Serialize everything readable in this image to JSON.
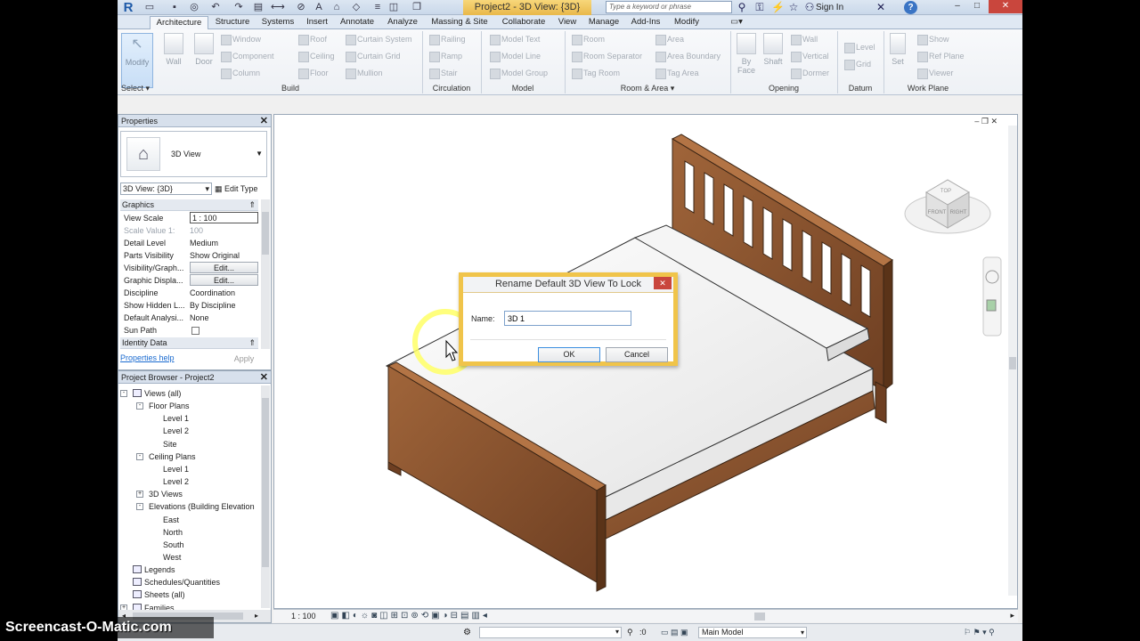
{
  "titlebar": {
    "title": "Project2 - 3D View: {3D}",
    "search_placeholder": "Type a keyword or phrase",
    "signin": "Sign In"
  },
  "ribbon_tabs": [
    "Architecture",
    "Structure",
    "Systems",
    "Insert",
    "Annotate",
    "Analyze",
    "Massing & Site",
    "Collaborate",
    "View",
    "Manage",
    "Add-Ins",
    "Modify"
  ],
  "ribbon": {
    "modify": "Modify",
    "select": "Select",
    "wall": "Wall",
    "door": "Door",
    "build_items": [
      "Window",
      "Component",
      "Column",
      "Roof",
      "Ceiling",
      "Floor",
      "Curtain System",
      "Curtain Grid",
      "Mullion"
    ],
    "circulation_items": [
      "Railing",
      "Ramp",
      "Stair"
    ],
    "model_items": [
      "Model Text",
      "Model Line",
      "Model Group"
    ],
    "room_items": [
      "Room",
      "Room Separator",
      "Tag Room",
      "Area",
      "Area Boundary",
      "Tag Area"
    ],
    "opening_items": [
      "By Face",
      "Shaft",
      "Wall",
      "Vertical",
      "Dormer"
    ],
    "datum_items": [
      "Level",
      "Grid"
    ],
    "workplane_items": [
      "Set",
      "Show",
      "Ref Plane",
      "Viewer"
    ],
    "panels": [
      "Build",
      "Circulation",
      "Model",
      "Room & Area",
      "Opening",
      "Datum",
      "Work Plane"
    ]
  },
  "properties": {
    "title": "Properties",
    "type_name": "3D View",
    "instance": "3D View: {3D}",
    "edit_type": "Edit Type",
    "group_graphics": "Graphics",
    "group_identity": "Identity Data",
    "rows": [
      {
        "name": "View Scale",
        "value": "1 : 100"
      },
      {
        "name": "Scale Value    1:",
        "value": "100"
      },
      {
        "name": "Detail Level",
        "value": "Medium"
      },
      {
        "name": "Parts Visibility",
        "value": "Show Original"
      },
      {
        "name": "Visibility/Graph...",
        "value": "Edit..."
      },
      {
        "name": "Graphic Displa...",
        "value": "Edit..."
      },
      {
        "name": "Discipline",
        "value": "Coordination"
      },
      {
        "name": "Show Hidden L...",
        "value": "By Discipline"
      },
      {
        "name": "Default Analysi...",
        "value": "None"
      },
      {
        "name": "Sun Path",
        "value": ""
      }
    ],
    "help": "Properties help",
    "apply": "Apply"
  },
  "browser": {
    "title": "Project Browser - Project2",
    "items": [
      {
        "label": "Views (all)",
        "indent": 0,
        "toggle": "-"
      },
      {
        "label": "Floor Plans",
        "indent": 1,
        "toggle": "-"
      },
      {
        "label": "Level 1",
        "indent": 2,
        "toggle": ""
      },
      {
        "label": "Level 2",
        "indent": 2,
        "toggle": ""
      },
      {
        "label": "Site",
        "indent": 2,
        "toggle": ""
      },
      {
        "label": "Ceiling Plans",
        "indent": 1,
        "toggle": "-"
      },
      {
        "label": "Level 1",
        "indent": 2,
        "toggle": ""
      },
      {
        "label": "Level 2",
        "indent": 2,
        "toggle": ""
      },
      {
        "label": "3D Views",
        "indent": 1,
        "toggle": "+"
      },
      {
        "label": "Elevations (Building Elevation",
        "indent": 1,
        "toggle": "-"
      },
      {
        "label": "East",
        "indent": 2,
        "toggle": ""
      },
      {
        "label": "North",
        "indent": 2,
        "toggle": ""
      },
      {
        "label": "South",
        "indent": 2,
        "toggle": ""
      },
      {
        "label": "West",
        "indent": 2,
        "toggle": ""
      },
      {
        "label": "Legends",
        "indent": 0,
        "toggle": ""
      },
      {
        "label": "Schedules/Quantities",
        "indent": 0,
        "toggle": ""
      },
      {
        "label": "Sheets (all)",
        "indent": 0,
        "toggle": ""
      },
      {
        "label": "Families",
        "indent": 0,
        "toggle": "+"
      }
    ]
  },
  "viewcube": {
    "top": "TOP",
    "front": "FRONT",
    "right": "RIGHT"
  },
  "view_controls": {
    "scale": "1 : 100"
  },
  "status": {
    "coord": ":0",
    "model": "Main Model"
  },
  "dialog": {
    "title": "Rename Default 3D View To Lock",
    "name_label": "Name:",
    "name_value": "3D 1",
    "ok": "OK",
    "cancel": "Cancel"
  },
  "watermark": "Screencast-O-Matic.com",
  "colors": {
    "wood": "#7a4a2a",
    "wood_light": "#b37445",
    "mattress": "#f2f2f2",
    "dialog_border": "#f0c44a",
    "highlight": "#ffff66"
  }
}
